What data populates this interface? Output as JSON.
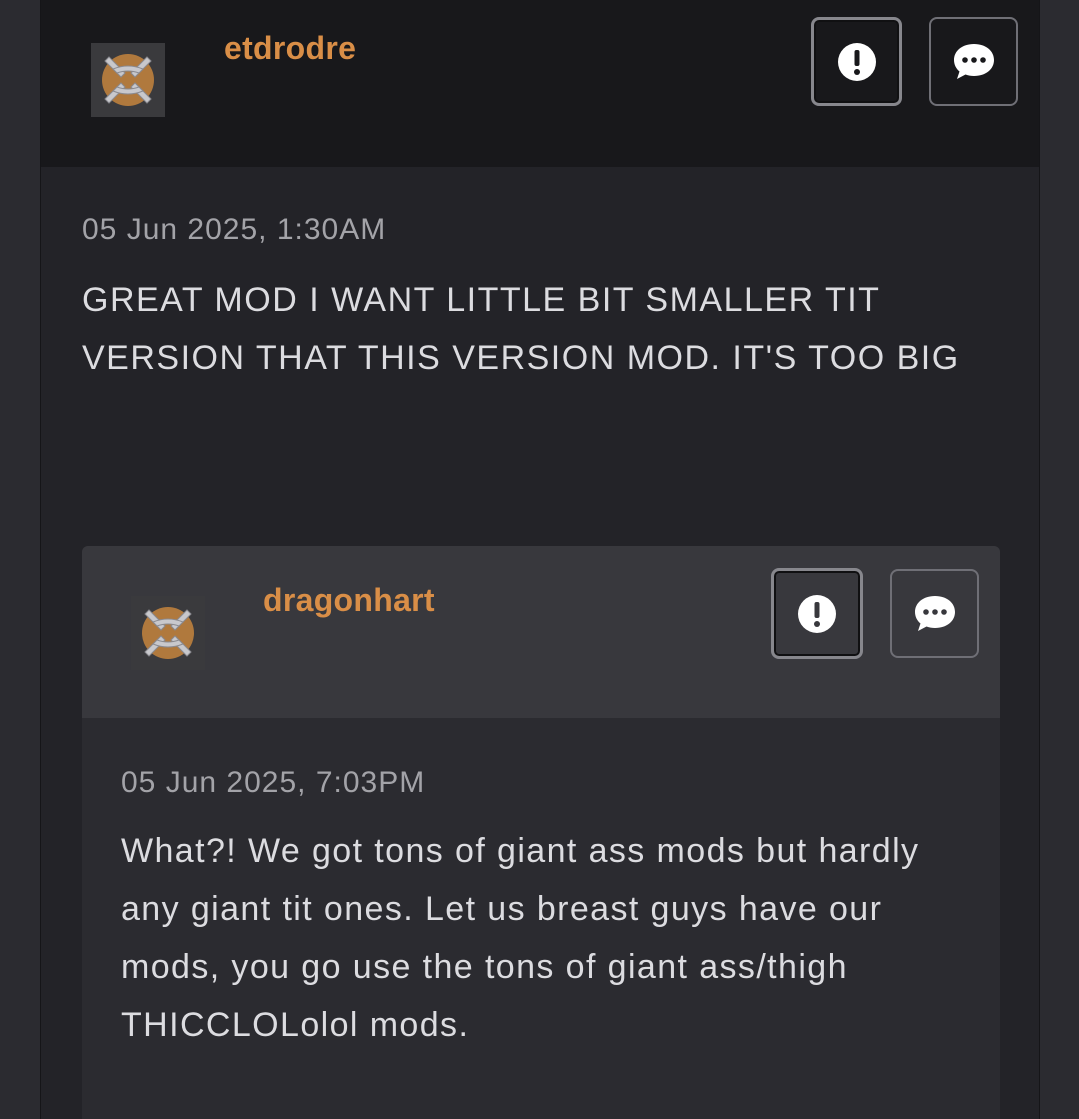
{
  "comment": {
    "username": "etdrodre",
    "timestamp": "05 Jun 2025, 1:30AM",
    "body": "GREAT MOD I WANT LITTLE BIT SMALLER TIT VERSION THAT THIS VERSION MOD. IT'S TOO BIG",
    "actions": [
      {
        "icon": "exclamation-circle-icon"
      },
      {
        "icon": "speech-bubble-icon"
      }
    ]
  },
  "reply": {
    "username": "dragonhart",
    "timestamp": "05 Jun 2025, 7:03PM",
    "body": "What?! We got tons of giant ass mods but hardly any giant tit ones. Let us breast guys have our mods, you go use the tons of giant ass/thigh THICCLOLolol mods.",
    "actions": [
      {
        "icon": "exclamation-circle-icon"
      },
      {
        "icon": "speech-bubble-icon"
      }
    ]
  },
  "colors": {
    "username": "#d98e47",
    "background": "#232328",
    "header": "#18181b"
  }
}
